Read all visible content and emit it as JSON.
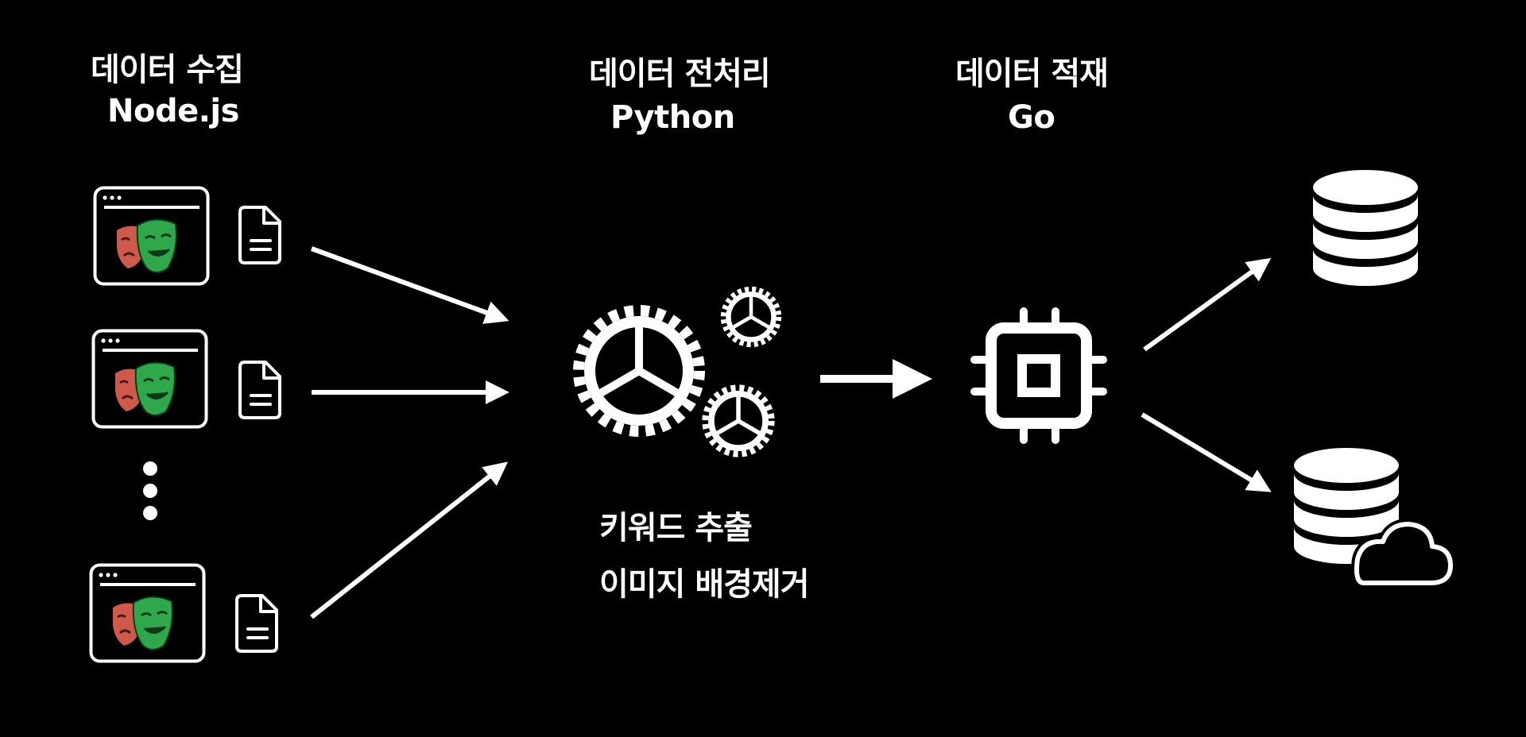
{
  "colors": {
    "background": "#000000",
    "foreground": "#ffffff",
    "mask_red": "#cf5a4c",
    "mask_green": "#2ea84a"
  },
  "stages": {
    "collect": {
      "title": "데이터 수집",
      "tech": "Node.js"
    },
    "preprocess": {
      "title": "데이터 전처리",
      "tech": "Python"
    },
    "load": {
      "title": "데이터 적재",
      "tech": "Go"
    }
  },
  "preprocess_tasks": [
    "키워드 추출",
    "이미지 배경제거"
  ],
  "icons": {
    "browser": "playwright-browser-window-icon",
    "document": "document-icon",
    "ellipsis": "vertical-ellipsis-icon",
    "gears": "gears-icon",
    "processor": "cpu-chip-icon",
    "database": "database-icon",
    "cloud_database": "cloud-database-icon"
  }
}
